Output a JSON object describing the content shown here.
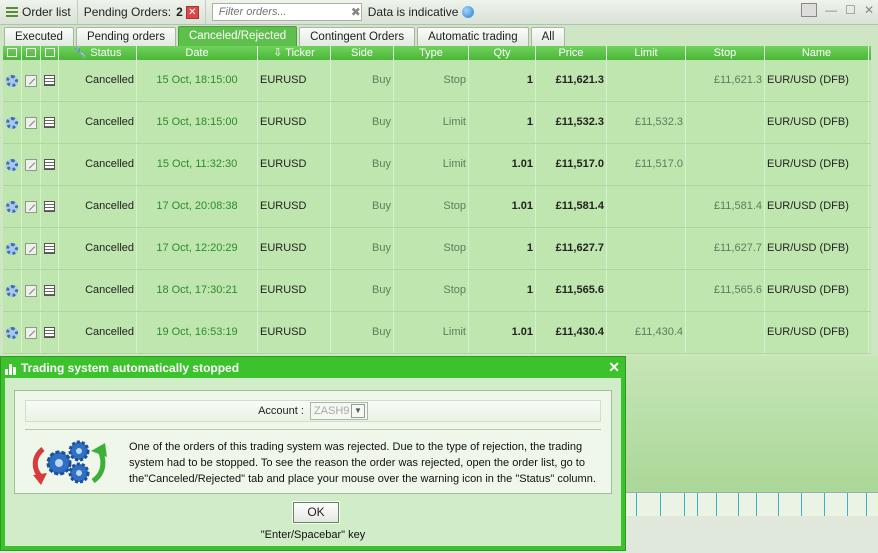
{
  "toolbar": {
    "order_list": "Order list",
    "pending_label": "Pending Orders:",
    "pending_count": "2",
    "filter_placeholder": "Filter orders...",
    "indicative": "Data is indicative"
  },
  "tabs": [
    "Executed",
    "Pending orders",
    "Canceled/Rejected",
    "Contingent Orders",
    "Automatic trading",
    "All"
  ],
  "active_tab": 2,
  "columns": [
    "Status",
    "Date",
    "Ticker",
    "Side",
    "Type",
    "Qty",
    "Price",
    "Limit",
    "Stop",
    "Name"
  ],
  "rows": [
    {
      "status": "Cancelled",
      "date": "15 Oct, 18:15:00",
      "ticker": "EURUSD",
      "side": "Buy",
      "type": "Stop",
      "qty": "1",
      "price": "£11,621.3",
      "limit": "",
      "stop": "£11,621.3",
      "name": "EUR/USD (DFB)"
    },
    {
      "status": "Cancelled",
      "date": "15 Oct, 18:15:00",
      "ticker": "EURUSD",
      "side": "Buy",
      "type": "Limit",
      "qty": "1",
      "price": "£11,532.3",
      "limit": "£11,532.3",
      "stop": "",
      "name": "EUR/USD (DFB)"
    },
    {
      "status": "Cancelled",
      "date": "15 Oct, 11:32:30",
      "ticker": "EURUSD",
      "side": "Buy",
      "type": "Limit",
      "qty": "1.01",
      "price": "£11,517.0",
      "limit": "£11,517.0",
      "stop": "",
      "name": "EUR/USD (DFB)"
    },
    {
      "status": "Cancelled",
      "date": "17 Oct, 20:08:38",
      "ticker": "EURUSD",
      "side": "Buy",
      "type": "Stop",
      "qty": "1.01",
      "price": "£11,581.4",
      "limit": "",
      "stop": "£11,581.4",
      "name": "EUR/USD (DFB)"
    },
    {
      "status": "Cancelled",
      "date": "17 Oct, 12:20:29",
      "ticker": "EURUSD",
      "side": "Buy",
      "type": "Stop",
      "qty": "1",
      "price": "£11,627.7",
      "limit": "",
      "stop": "£11,627.7",
      "name": "EUR/USD (DFB)"
    },
    {
      "status": "Cancelled",
      "date": "18 Oct, 17:30:21",
      "ticker": "EURUSD",
      "side": "Buy",
      "type": "Stop",
      "qty": "1",
      "price": "£11,565.6",
      "limit": "",
      "stop": "£11,565.6",
      "name": "EUR/USD (DFB)"
    },
    {
      "status": "Cancelled",
      "date": "19 Oct, 16:53:19",
      "ticker": "EURUSD",
      "side": "Buy",
      "type": "Limit",
      "qty": "1.01",
      "price": "£11,430.4",
      "limit": "£11,430.4",
      "stop": "",
      "name": "EUR/USD (DFB)"
    }
  ],
  "dialog": {
    "title": "Trading system automatically stopped",
    "account_label": "Account :",
    "account_value": "ZASH9",
    "message": "One of the orders of this trading system was rejected. Due to the type of rejection, the trading system had to be stopped. To see the reason the order was rejected, open the order list, go to the\"Canceled/Rejected\" tab and place your mouse over the warning icon in the \"Status\" column.",
    "ok": "OK",
    "hint": "\"Enter/Spacebar\" key"
  },
  "colors": {
    "accent": "#4bb539",
    "row": "#bfe6ae",
    "dialog": "#3cc22c"
  }
}
